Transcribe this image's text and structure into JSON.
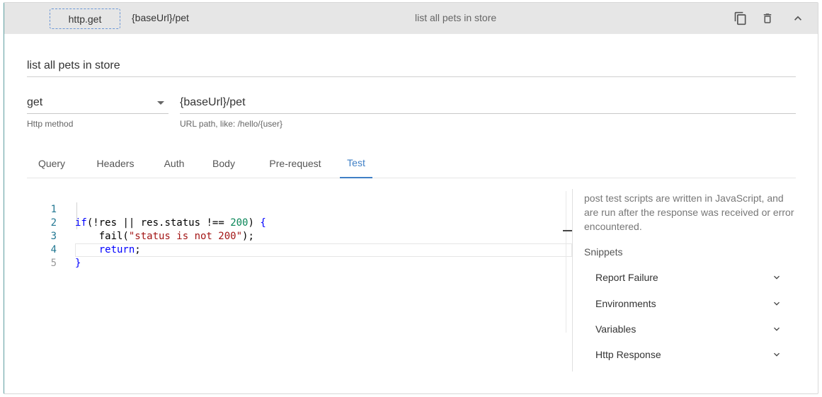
{
  "header": {
    "method_badge": "http.get",
    "path": "{baseUrl}/pet",
    "description": "list all pets in store",
    "icons": [
      "copy-icon",
      "delete-icon",
      "chevron-up-icon"
    ]
  },
  "form": {
    "description_value": "list all pets in store",
    "method_value": "get",
    "method_hint": "Http method",
    "path_value": "{baseUrl}/pet",
    "path_hint": "URL path, like: /hello/{user}"
  },
  "tabs": [
    {
      "label": "Query"
    },
    {
      "label": "Headers"
    },
    {
      "label": "Auth"
    },
    {
      "label": "Body"
    },
    {
      "label": "Pre-request"
    },
    {
      "label": "Test",
      "active": true
    }
  ],
  "editor": {
    "line_numbers": [
      "1",
      "2",
      "3",
      "4",
      "5"
    ],
    "lines": [
      {
        "tokens": [
          [
            "kw",
            "if"
          ],
          [
            "",
            "("
          ],
          [
            "",
            "!res"
          ],
          [
            "",
            " || "
          ],
          [
            "",
            "res.status"
          ],
          [
            "",
            " !== "
          ],
          [
            "num",
            "200"
          ],
          [
            "",
            ") "
          ],
          [
            "kw",
            "{"
          ]
        ]
      },
      {
        "tokens": [
          [
            "",
            "    fail("
          ],
          [
            "str",
            "\"status is not 200\""
          ],
          [
            "",
            ");"
          ]
        ]
      },
      {
        "tokens": [
          [
            "",
            "    "
          ],
          [
            "kw",
            "return"
          ],
          [
            "",
            ";"
          ]
        ]
      },
      {
        "tokens": [
          [
            "kw",
            "}"
          ]
        ]
      },
      {
        "tokens": []
      }
    ]
  },
  "sidebar": {
    "help_text": "post test scripts are written in JavaScript, and are run after the response was received or error encountered.",
    "snippets_title": "Snippets",
    "snippets": [
      {
        "label": "Report Failure"
      },
      {
        "label": "Environments"
      },
      {
        "label": "Variables"
      },
      {
        "label": "Http Response"
      }
    ]
  },
  "colors": {
    "accent": "#3f7fc6",
    "header_bg": "#e6e6e6"
  }
}
